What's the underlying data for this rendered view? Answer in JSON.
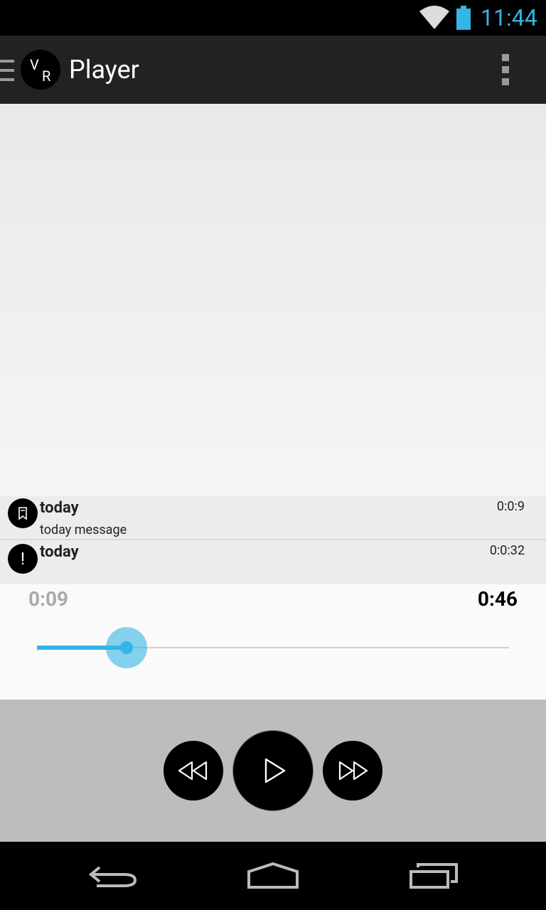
{
  "status_bar": {
    "time": "11:44",
    "icons": [
      "wifi-icon",
      "battery-icon"
    ],
    "accent_color": "#33b5e5"
  },
  "app_bar": {
    "logo_letters": [
      "V",
      "R"
    ],
    "title": "Player",
    "icons": [
      "drawer-icon",
      "overflow-menu-icon"
    ]
  },
  "events": [
    {
      "icon": "bookmark-icon",
      "title": "today",
      "message": "today message",
      "time": "0:0:9"
    },
    {
      "icon": "alert-icon",
      "glyph": "!",
      "title": "today",
      "message": "",
      "time": "0:0:32"
    }
  ],
  "playback": {
    "elapsed": "0:09",
    "total": "0:46",
    "progress_fraction": 0.19
  },
  "controls": {
    "icons": [
      "rewind-icon",
      "play-icon",
      "fast-forward-icon"
    ]
  },
  "nav_bar": {
    "icons": [
      "back-icon",
      "home-icon",
      "recent-apps-icon"
    ]
  }
}
